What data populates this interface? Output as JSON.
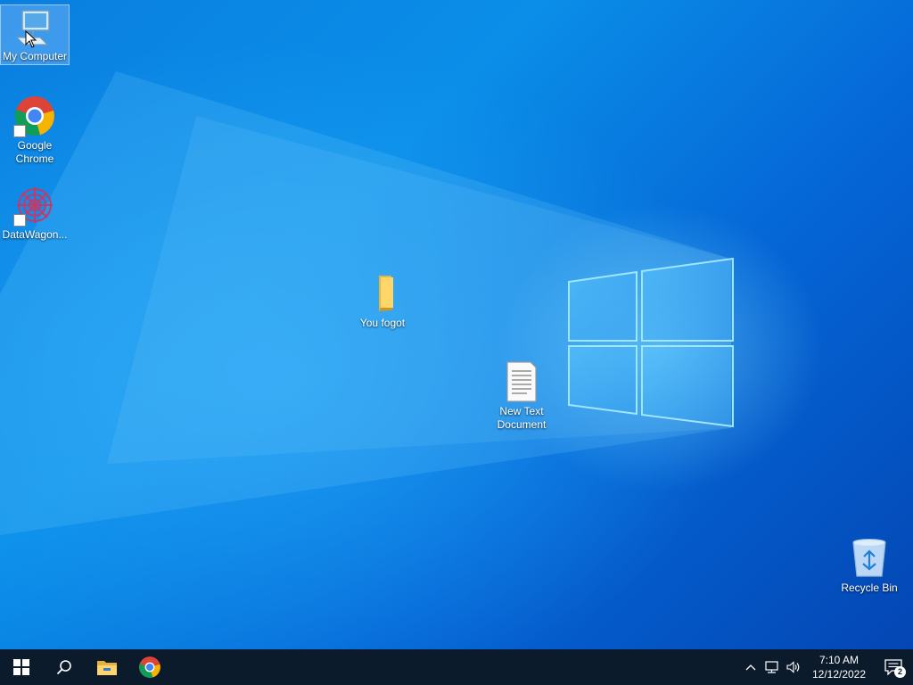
{
  "desktop": {
    "icons": [
      {
        "label": "My Computer",
        "icon": "computer-icon",
        "selected": true
      },
      {
        "label": "Google Chrome",
        "icon": "chrome-icon",
        "shortcut": true
      },
      {
        "label": "DataWagon...",
        "icon": "datawagon-icon",
        "shortcut": true
      },
      {
        "label": "You fogot",
        "icon": "folder-icon"
      },
      {
        "label": "New Text Document",
        "icon": "text-document-icon"
      },
      {
        "label": "Recycle Bin",
        "icon": "recycle-bin-icon"
      }
    ]
  },
  "taskbar": {
    "buttons": [
      {
        "icon": "windows-start-icon"
      },
      {
        "icon": "search-icon"
      },
      {
        "icon": "file-explorer-icon"
      },
      {
        "icon": "chrome-icon"
      }
    ],
    "tray": {
      "icons": [
        "chevron-up-icon",
        "network-icon",
        "volume-icon"
      ],
      "time": "7:10 AM",
      "date": "12/12/2022",
      "notifications_count": "2"
    }
  },
  "colors": {
    "taskbar": "#0c1b2c",
    "desktop_blue": "#0a7fe0",
    "logo_light": "#7fd8ff"
  }
}
